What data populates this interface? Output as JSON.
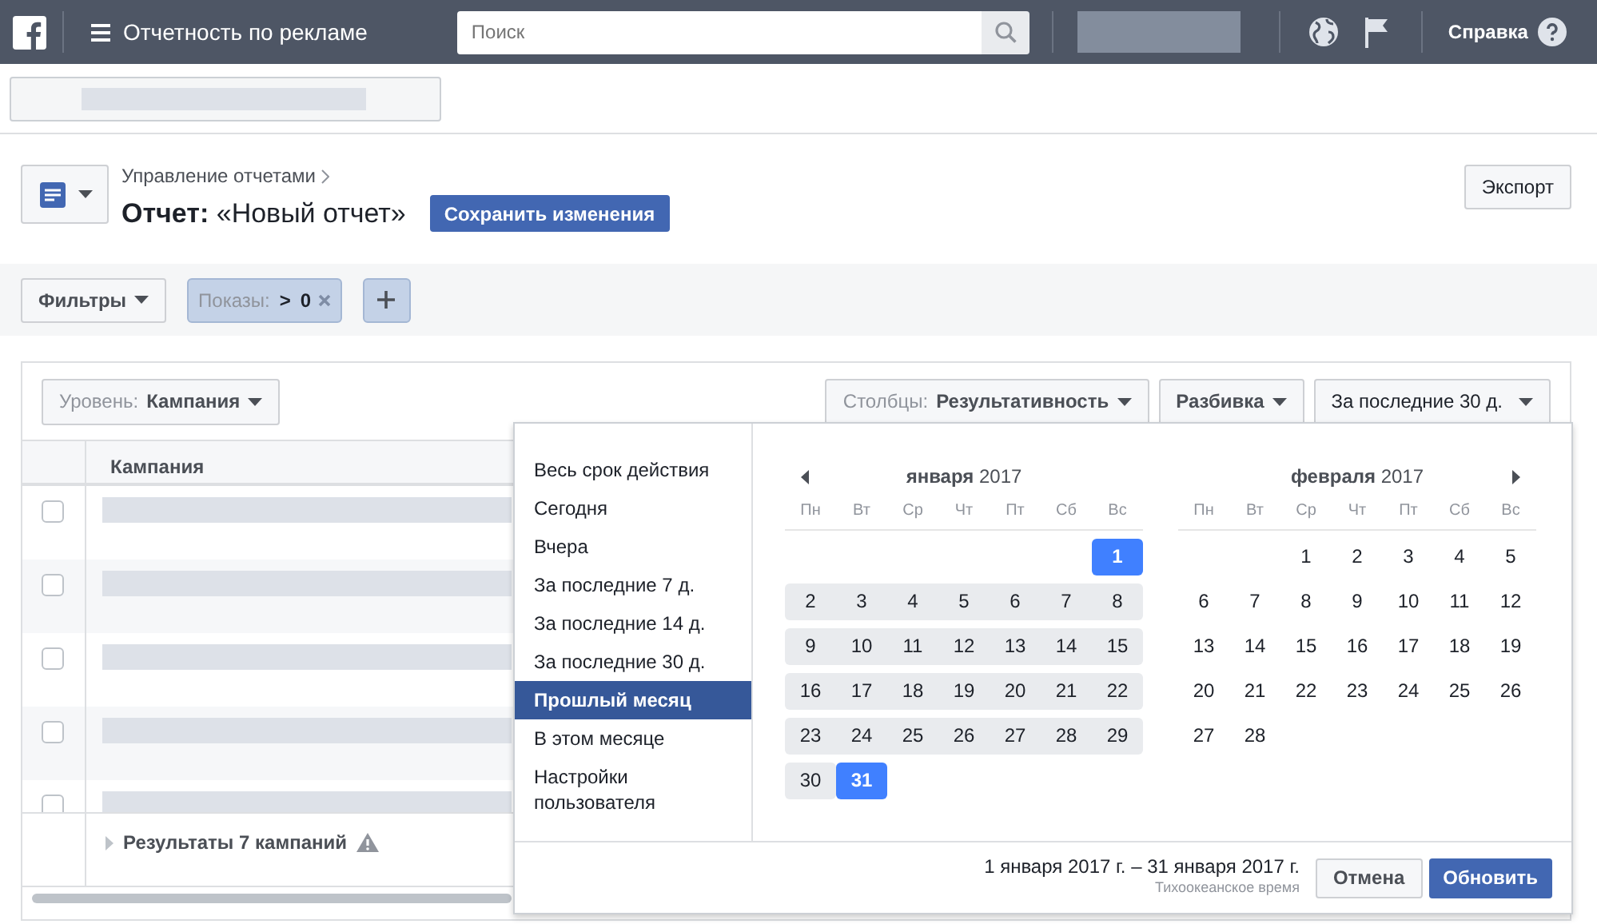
{
  "top_bar": {
    "title": "Отчетность по рекламе",
    "search": {
      "placeholder": "Поиск"
    },
    "help": "Справка"
  },
  "report_header": {
    "breadcrumb": "Управление отчетами",
    "title": "**Отчет:** «Новый отчет»",
    "save_button": "Сохранить изменения",
    "export_button": "Экспорт"
  },
  "filters": {
    "button": "Фильтры",
    "chips": [
      {
        "label": "Показы:",
        "operator": ">",
        "value": "0"
      }
    ]
  },
  "table_toolbar": {
    "level": {
      "label": "Уровень:",
      "value": "Кампания"
    },
    "columns": {
      "label": "Столбцы:",
      "value": "Результативность"
    },
    "breakdown": "Разбивка",
    "date_preset": "За последние 30 д."
  },
  "table": {
    "columns": [
      "Кампания"
    ],
    "rows": [
      {
        "checked": false
      },
      {
        "checked": false
      },
      {
        "checked": false
      },
      {
        "checked": false
      },
      {
        "checked": false
      }
    ],
    "summary": "Результаты 7 кампаний"
  },
  "date_picker": {
    "presets": [
      {
        "label": "Весь срок действия",
        "selected": false
      },
      {
        "label": "Сегодня",
        "selected": false
      },
      {
        "label": "Вчера",
        "selected": false
      },
      {
        "label": "За последние 7 д.",
        "selected": false
      },
      {
        "label": "За последние 14 д.",
        "selected": false
      },
      {
        "label": "За последние 30 д.",
        "selected": false
      },
      {
        "label": "Прошлый месяц",
        "selected": true
      },
      {
        "label": "В этом месяце",
        "selected": false
      },
      {
        "label": "Настройки пользователя",
        "selected": false
      }
    ],
    "months": [
      {
        "title": "**января** 2017",
        "weekdays": [
          "Пн",
          "Вт",
          "Ср",
          "Чт",
          "Пт",
          "Сб",
          "Вс"
        ],
        "weeks": [
          {
            "kind": "opening",
            "days": [
              {
                "day": "1",
                "in_range": true,
                "selected": true
              }
            ]
          },
          {
            "days": [
              {
                "day": "2",
                "in_range": true,
                "selected": false
              },
              {
                "day": "3",
                "in_range": true,
                "selected": false
              },
              {
                "day": "4",
                "in_range": true,
                "selected": false
              },
              {
                "day": "5",
                "in_range": true,
                "selected": false
              },
              {
                "day": "6",
                "in_range": true,
                "selected": false
              },
              {
                "day": "7",
                "in_range": true,
                "selected": false
              },
              {
                "day": "8",
                "in_range": true,
                "selected": false
              }
            ]
          },
          {
            "days": [
              {
                "day": "9",
                "in_range": true,
                "selected": false
              },
              {
                "day": "10",
                "in_range": true,
                "selected": false
              },
              {
                "day": "11",
                "in_range": true,
                "selected": false
              },
              {
                "day": "12",
                "in_range": true,
                "selected": false
              },
              {
                "day": "13",
                "in_range": true,
                "selected": false
              },
              {
                "day": "14",
                "in_range": true,
                "selected": false
              },
              {
                "day": "15",
                "in_range": true,
                "selected": false
              }
            ]
          },
          {
            "days": [
              {
                "day": "16",
                "in_range": true,
                "selected": false
              },
              {
                "day": "17",
                "in_range": true,
                "selected": false
              },
              {
                "day": "18",
                "in_range": true,
                "selected": false
              },
              {
                "day": "19",
                "in_range": true,
                "selected": false
              },
              {
                "day": "20",
                "in_range": true,
                "selected": false
              },
              {
                "day": "21",
                "in_range": true,
                "selected": false
              },
              {
                "day": "22",
                "in_range": true,
                "selected": false
              }
            ]
          },
          {
            "days": [
              {
                "day": "23",
                "in_range": true,
                "selected": false
              },
              {
                "day": "24",
                "in_range": true,
                "selected": false
              },
              {
                "day": "25",
                "in_range": true,
                "selected": false
              },
              {
                "day": "26",
                "in_range": true,
                "selected": false
              },
              {
                "day": "27",
                "in_range": true,
                "selected": false
              },
              {
                "day": "28",
                "in_range": true,
                "selected": false
              },
              {
                "day": "29",
                "in_range": true,
                "selected": false
              }
            ]
          },
          {
            "days": [
              {
                "day": "30",
                "in_range": true,
                "selected": false
              },
              {
                "day": "31",
                "in_range": true,
                "selected": true
              }
            ]
          }
        ]
      },
      {
        "title": "**февраля** 2017",
        "weekdays": [
          "Пн",
          "Вт",
          "Ср",
          "Чт",
          "Пт",
          "Сб",
          "Вс"
        ],
        "weeks": [
          {
            "kind": "opening",
            "days": [
              {
                "day": "1",
                "in_range": false,
                "selected": false
              },
              {
                "day": "2",
                "in_range": false,
                "selected": false
              },
              {
                "day": "3",
                "in_range": false,
                "selected": false
              },
              {
                "day": "4",
                "in_range": false,
                "selected": false
              },
              {
                "day": "5",
                "in_range": false,
                "selected": false
              }
            ]
          },
          {
            "days": [
              {
                "day": "6",
                "in_range": false,
                "selected": false
              },
              {
                "day": "7",
                "in_range": false,
                "selected": false
              },
              {
                "day": "8",
                "in_range": false,
                "selected": false
              },
              {
                "day": "9",
                "in_range": false,
                "selected": false
              },
              {
                "day": "10",
                "in_range": false,
                "selected": false
              },
              {
                "day": "11",
                "in_range": false,
                "selected": false
              },
              {
                "day": "12",
                "in_range": false,
                "selected": false
              }
            ]
          },
          {
            "days": [
              {
                "day": "13",
                "in_range": false,
                "selected": false
              },
              {
                "day": "14",
                "in_range": false,
                "selected": false
              },
              {
                "day": "15",
                "in_range": false,
                "selected": false
              },
              {
                "day": "16",
                "in_range": false,
                "selected": false
              },
              {
                "day": "17",
                "in_range": false,
                "selected": false
              },
              {
                "day": "18",
                "in_range": false,
                "selected": false
              },
              {
                "day": "19",
                "in_range": false,
                "selected": false
              }
            ]
          },
          {
            "days": [
              {
                "day": "20",
                "in_range": false,
                "selected": false
              },
              {
                "day": "21",
                "in_range": false,
                "selected": false
              },
              {
                "day": "22",
                "in_range": false,
                "selected": false
              },
              {
                "day": "23",
                "in_range": false,
                "selected": false
              },
              {
                "day": "24",
                "in_range": false,
                "selected": false
              },
              {
                "day": "25",
                "in_range": false,
                "selected": false
              },
              {
                "day": "26",
                "in_range": false,
                "selected": false
              }
            ]
          },
          {
            "days": [
              {
                "day": "27",
                "in_range": false,
                "selected": false
              },
              {
                "day": "28",
                "in_range": false,
                "selected": false
              }
            ]
          }
        ]
      }
    ],
    "range_text": "1 января 2017 г. – 31 января 2017 г.",
    "timezone": "Тихоокеанское время",
    "cancel_button": "Отмена",
    "update_button": "Обновить"
  }
}
